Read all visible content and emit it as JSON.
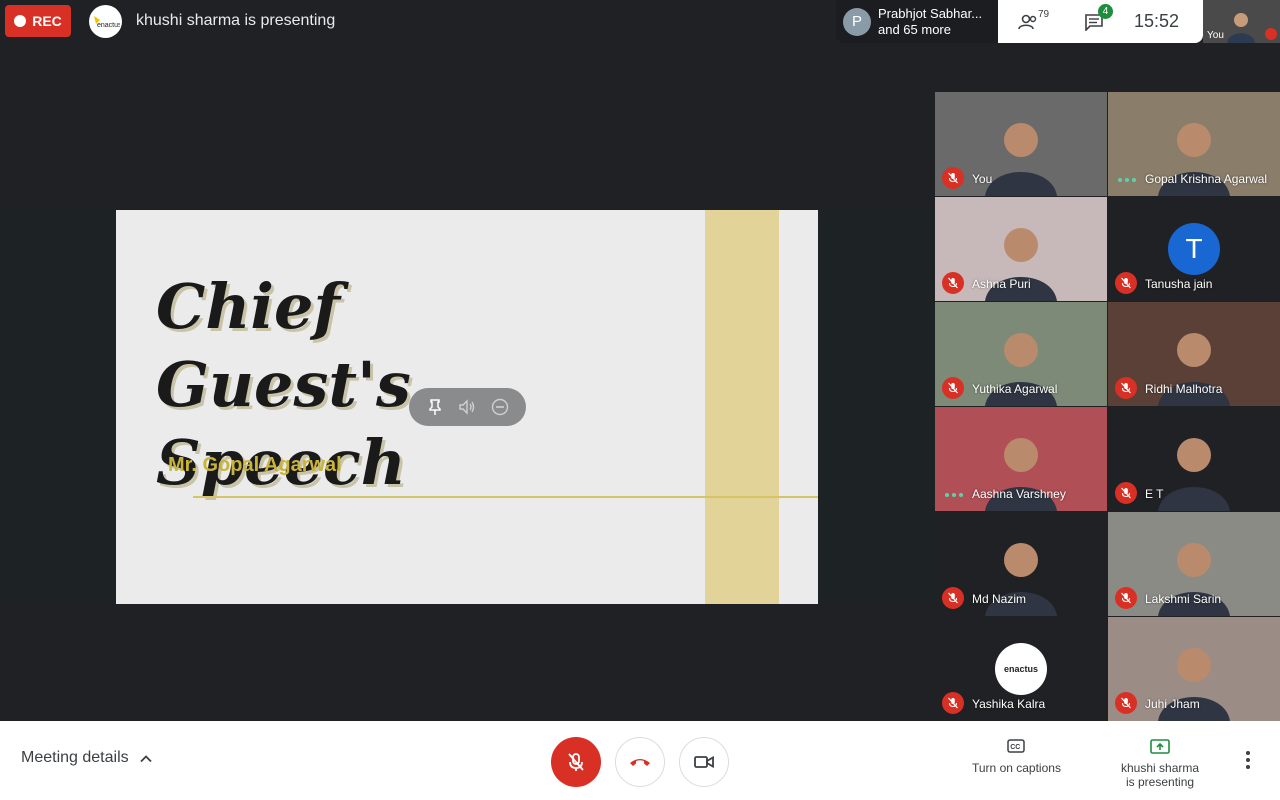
{
  "top_bar": {
    "rec_label": "REC",
    "presenter_text": "khushi sharma is presenting",
    "people_preview": {
      "avatar_letter": "P",
      "line1": "Prabhjot Sabhar...",
      "line2": "and 65 more"
    },
    "participant_count": "79",
    "chat_badge": "4",
    "clock": "15:52",
    "self_label": "You"
  },
  "slide": {
    "title_line1": "Chief Guest's",
    "title_line2": "Speech",
    "subtitle": "Mr. Gopal Agarwal"
  },
  "participants": [
    {
      "name": "You",
      "status": "muted",
      "bg": "#6a6a6a"
    },
    {
      "name": "Gopal Krishna Agarwal",
      "status": "speaking",
      "bg": "#8a7d6a"
    },
    {
      "name": "Ashna Puri",
      "status": "muted",
      "bg": "#c7b9b9"
    },
    {
      "name": "Tanusha jain",
      "status": "muted",
      "avatar": "T",
      "bg": "#202124"
    },
    {
      "name": "Yuthika Agarwal",
      "status": "muted",
      "bg": "#7d8a78"
    },
    {
      "name": "Ridhi Malhotra",
      "status": "muted",
      "bg": "#5a4036"
    },
    {
      "name": "Aashna Varshney",
      "status": "speaking",
      "bg": "#b04f55"
    },
    {
      "name": "E T",
      "status": "muted",
      "bg": "#202124"
    },
    {
      "name": "Md Nazim",
      "status": "muted",
      "bg": "#202124"
    },
    {
      "name": "Lakshmi Sarin",
      "status": "muted",
      "bg": "#8b8b86"
    },
    {
      "name": "Yashika Kalra",
      "status": "muted",
      "logo": "enactus",
      "bg": "#202124"
    },
    {
      "name": "Juhi Jham",
      "status": "muted",
      "bg": "#9c8c86"
    }
  ],
  "bottom_bar": {
    "meeting_details": "Meeting details",
    "captions_label": "Turn on captions",
    "present_line1": "khushi sharma",
    "present_line2": "is presenting"
  },
  "logo_text": "enactus",
  "colors": {
    "rec": "#d93025",
    "mic_off": "#d93025",
    "speaking": "#5bd2a8",
    "avatar_blue": "#1967d2",
    "present_green": "#1e8e3e"
  }
}
